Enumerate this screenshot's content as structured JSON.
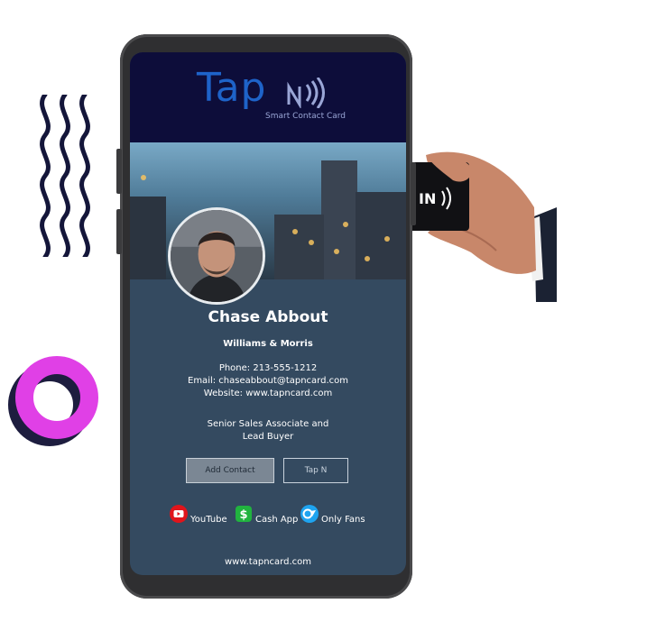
{
  "brand": {
    "logo_text": "Tap",
    "tagline": "Smart Contact Card"
  },
  "profile": {
    "name": "Chase Abbout",
    "company": "Williams & Morris",
    "phone": "Phone: 213-555-1212",
    "email": "Email: chaseabbout@tapncard.com",
    "website": "Website: www.tapncard.com",
    "title_line1": "Senior Sales Associate and",
    "title_line2": "Lead Buyer"
  },
  "buttons": {
    "add_contact": "Add Contact",
    "tap_n": "Tap N"
  },
  "social": [
    {
      "label": "YouTube",
      "icon": "youtube-icon",
      "color": "#e0141b"
    },
    {
      "label": "Cash App",
      "icon": "cash-app-icon",
      "color": "#21b33f"
    },
    {
      "label": "Only Fans",
      "icon": "only-fans-icon",
      "color": "#1ea4f0"
    }
  ],
  "footer": {
    "url": "www.tapncard.com"
  },
  "card": {
    "text": "IN"
  },
  "colors": {
    "screen_bg": "#344a60",
    "header_bg": "#0d0d3a",
    "logo_blue": "#1e63c9",
    "ring_magenta": "#e040e6",
    "waves_navy": "#14163a"
  }
}
